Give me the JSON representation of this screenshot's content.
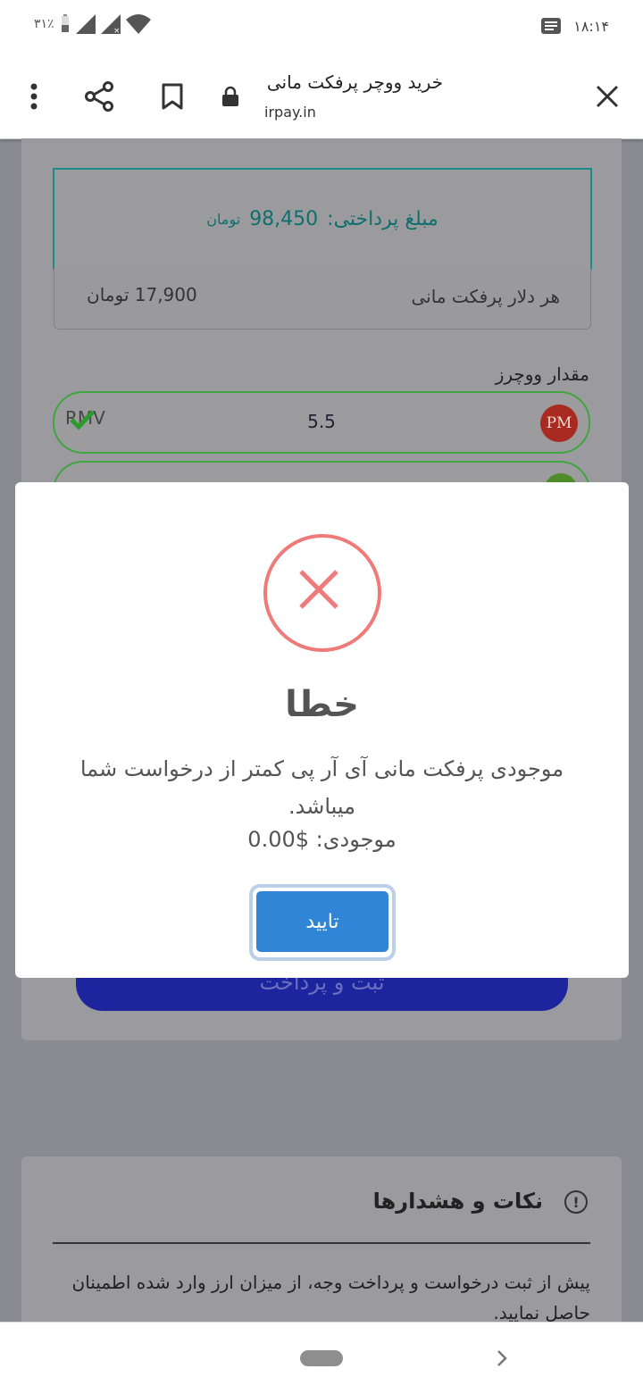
{
  "statusbar": {
    "time": "۱۸:۱۴",
    "battery": "۳۱٪"
  },
  "topbar": {
    "title": "خرید ووچر پرفکت مانی",
    "url": "irpay.in"
  },
  "payment": {
    "label": "مبلغ پرداختی:",
    "amount": "98,450",
    "unit": "تومان"
  },
  "rate": {
    "label": "هر دلار پرفکت مانی",
    "value": "17,900 تومان"
  },
  "voucher": {
    "label": "مقدار ووچرز",
    "amount": "5.5",
    "code": "RMV",
    "logo_text": "PM"
  },
  "submit": {
    "label": "ثبت و پرداخت"
  },
  "notes": {
    "title": "نکات و هشدارها",
    "text": "پیش از ثبت درخواست و پرداخت وجه، از میزان ارز وارد شده اطمینان حاصل نمایید."
  },
  "modal": {
    "title": "خطا",
    "message": "موجودی پرفکت مانی آی آر پی کمتر از درخواست شما میباشد.",
    "balance": "موجودی: $0.00",
    "confirm": "تایید",
    "icon_color": "#ef7a7a",
    "button_color": "#3085d6"
  }
}
